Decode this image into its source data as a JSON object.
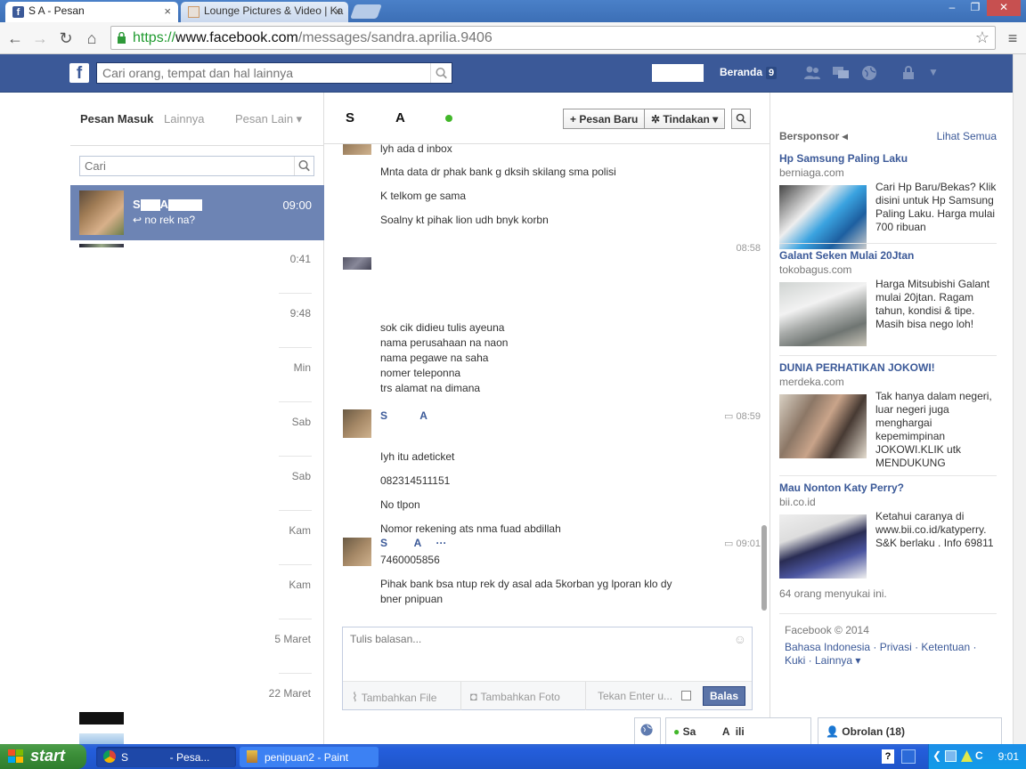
{
  "browser": {
    "tabs": [
      {
        "title": "S        A       - Pesan",
        "close": "×"
      },
      {
        "title": "Lounge Pictures & Video | Ka",
        "close": "×"
      }
    ],
    "window_buttons": [
      "–",
      "❐",
      "✕"
    ],
    "url": {
      "proto": "https://",
      "host": "www.facebook.com",
      "path": "/messages/sandra.aprilia.9406"
    }
  },
  "fb": {
    "logo": "f",
    "search_placeholder": "Cari orang, tempat dan hal lainnya",
    "beranda": "Beranda",
    "beranda_count": "9",
    "colors": {
      "brand": "#3b5998",
      "selected": "#6d84b4",
      "online": "#42b72a"
    }
  },
  "left": {
    "tabs": [
      "Pesan Masuk",
      "Lainnya",
      "Pesan Lain ▾"
    ],
    "search_placeholder": "Cari",
    "selected_conv": {
      "name": "S",
      "name2": "A",
      "time": "09:00",
      "snippet": "↩ no rek na?"
    },
    "conv_times": [
      "0:41",
      "9:48",
      "Min",
      "Sab",
      "Sab",
      "Kam",
      "Kam",
      "5 Maret",
      "22 Maret"
    ]
  },
  "chat": {
    "title_a": "S",
    "title_b": "A",
    "new_message": "+ Pesan Baru",
    "actions": "✲ Tindakan ▾",
    "messages_top": [
      "lyh ada d inbox",
      "Mnta data dr phak bank g dksih skilang sma polisi",
      "K telkom ge sama",
      "Soalny kt pihak lion udh bnyk korbn"
    ],
    "time1": "08:58",
    "messages_mid": [
      "sok cik didieu tulis ayeuna",
      "nama perusahaan na naon",
      "nama pegawe na saha",
      "nomer teleponna",
      "trs alamat na dimana"
    ],
    "sender1": "S           A",
    "time2": "08:59",
    "messages_b": [
      "Iyh itu adeticket",
      "082314511151",
      "No tlpon",
      "Nomor rekening ats nma fuad abdillah"
    ],
    "sender2": "S         A     ···",
    "time3": "09:01",
    "messages_c": [
      "7460005856",
      "Pihak bank bsa ntup rek dy asal ada 5korban yg lporan klo dy",
      "bner pnipuan"
    ],
    "reply_placeholder": "Tulis balasan...",
    "add_file": "Tambahkan File",
    "add_photo": "Tambahkan Foto",
    "enter_hint": "Tekan Enter u...",
    "send": "Balas"
  },
  "ads": {
    "header": "Bersponsor",
    "see_all": "Lihat Semua",
    "items": [
      {
        "title": "Hp Samsung Paling Laku",
        "domain": "berniaga.com",
        "text": "Cari Hp Baru/Bekas? Klik disini untuk Hp Samsung Paling Laku. Harga mulai 700 ribuan"
      },
      {
        "title": "Galant Seken Mulai 20Jtan",
        "domain": "tokobagus.com",
        "text": "Harga Mitsubishi Galant mulai 20jtan. Ragam tahun, kondisi & tipe. Masih bisa nego loh!"
      },
      {
        "title": "DUNIA PERHATIKAN JOKOWI!",
        "domain": "merdeka.com",
        "text": "Tak hanya dalam negeri, luar negeri juga menghargai kepemimpinan JOKOWI.KLIK utk MENDUKUNG"
      },
      {
        "title": "Mau Nonton Katy Perry?",
        "domain": "bii.co.id",
        "text": "Ketahui caranya di www.bii.co.id/katyperry. S&K berlaku . Info 69811",
        "likes": "64 orang menyukai ini."
      }
    ],
    "footer_copy": "Facebook © 2014",
    "footer_links": "Bahasa Indonesia · Privasi · Ketentuan · Kuki · Lainnya ▾"
  },
  "chatbar": {
    "contact": "Sa         A  ili",
    "chat": "Obrolan (18)"
  },
  "taskbar": {
    "start": "start",
    "items": [
      "S              - Pesa...",
      "penipuan2 - Paint"
    ],
    "clock": "9:01"
  }
}
